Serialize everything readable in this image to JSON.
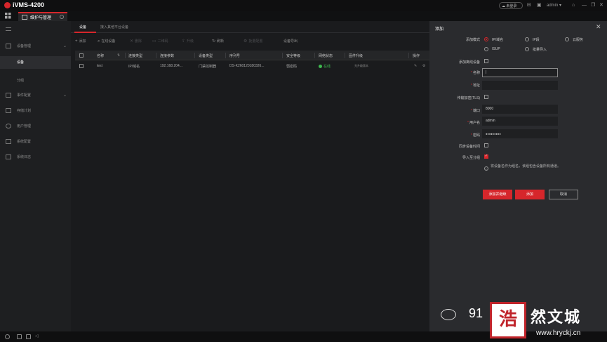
{
  "app": {
    "title": "iVMS-4200"
  },
  "titlebar": {
    "cloud_label": "未登录",
    "user": "admin"
  },
  "tabs": [
    {
      "label": "维护与管理"
    }
  ],
  "sidebar": {
    "items": [
      {
        "label": "设备管理"
      },
      {
        "label": "设备"
      },
      {
        "label": "分组"
      },
      {
        "label": "事件配置"
      },
      {
        "label": "存储计划"
      },
      {
        "label": "用户管理"
      },
      {
        "label": "系统配置"
      },
      {
        "label": "系统日志"
      }
    ]
  },
  "main": {
    "subtabs": [
      {
        "label": "设备"
      },
      {
        "label": "接入其他平台设备"
      }
    ],
    "toolbar": [
      {
        "icon": "+",
        "label": "添加"
      },
      {
        "icon": "⌕",
        "label": "在线设备"
      },
      {
        "icon": "✕",
        "label": "删除"
      },
      {
        "icon": "▭",
        "label": "二维码"
      },
      {
        "icon": "⇪",
        "label": "升级"
      },
      {
        "icon": "↻",
        "label": "刷新"
      },
      {
        "icon": "⚙",
        "label": "批量配置"
      },
      {
        "icon": "",
        "label": "设备导出"
      }
    ],
    "table": {
      "headers": [
        "名称",
        "连接类型",
        "连接参数",
        "设备类型",
        "序列号",
        "安全等级",
        "网络状态",
        "固件升级",
        "操作"
      ],
      "rows": [
        {
          "name": "test",
          "conn_type": "IP/域名",
          "conn_param": "192.168.204...",
          "dev_type": "门禁控制器",
          "serial": "DS-K260120180326...",
          "security": "弱密码",
          "status": "在线",
          "firmware": "无升级版本"
        }
      ]
    }
  },
  "panel": {
    "title": "添加",
    "mode_label": "添加模式",
    "modes": [
      "IP/域名",
      "IP段",
      "云服务",
      "ISUP",
      "批量导入"
    ],
    "offline_label": "添加离线设备",
    "name_label": "名称",
    "address_label": "地址",
    "tls_label": "传输加密(TLS)",
    "port_label": "端口",
    "port_value": "8000",
    "user_label": "用户名",
    "user_value": "admin",
    "password_label": "密码",
    "password_value": "●●●●●●●●●",
    "sync_label": "同步设备时间",
    "import_label": "导入至分组",
    "info_text": "将设备名作为组名，该组包含设备所有通道。",
    "btn_add_continue": "添加并继续",
    "btn_add": "添加",
    "btn_cancel": "取消"
  },
  "watermark": {
    "number": "91",
    "stamp": "浩",
    "text": "然文城",
    "url": "www.hryckj.cn"
  },
  "colors": {
    "accent": "#d6262b",
    "online": "#3fb950"
  }
}
